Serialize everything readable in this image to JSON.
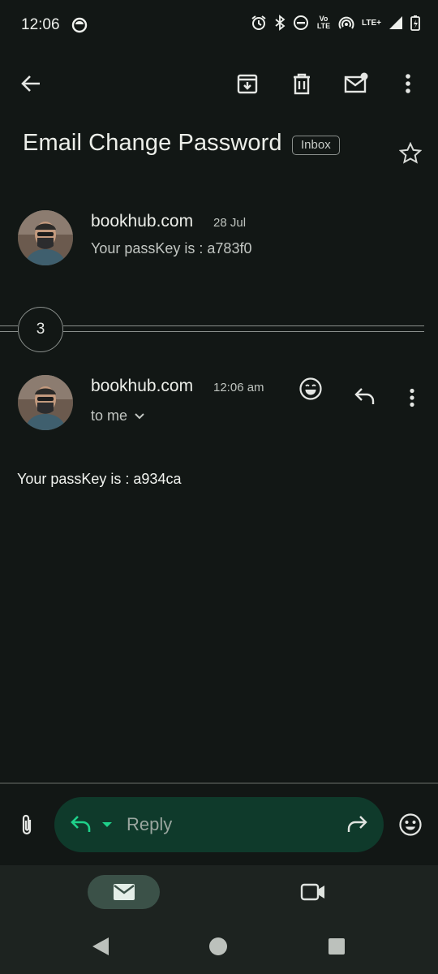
{
  "status_bar": {
    "time": "12:06",
    "volte_label": "Vo LTE",
    "lte_label": "LTE+"
  },
  "toolbar": {
    "icons": [
      "back-arrow-icon",
      "archive-icon",
      "delete-icon",
      "mark-unread-icon",
      "more-vert-icon"
    ]
  },
  "email": {
    "subject": "Email Change Password",
    "label_chip": "Inbox"
  },
  "thread": {
    "collapsed_message": {
      "sender": "bookhub.com",
      "date": "28 Jul",
      "snippet": "Your passKey is : a783f0"
    },
    "collapsed_count": "3",
    "expanded_message": {
      "sender": "bookhub.com",
      "time": "12:06 am",
      "recipient": "to me",
      "body": "Your passKey is : a934ca"
    }
  },
  "reply_bar": {
    "reply_label": "Reply"
  },
  "colors": {
    "background": "#121715",
    "reply_pill": "#0f3a2b",
    "accent_green": "#1fd08a",
    "nav_active": "#3b5148"
  }
}
